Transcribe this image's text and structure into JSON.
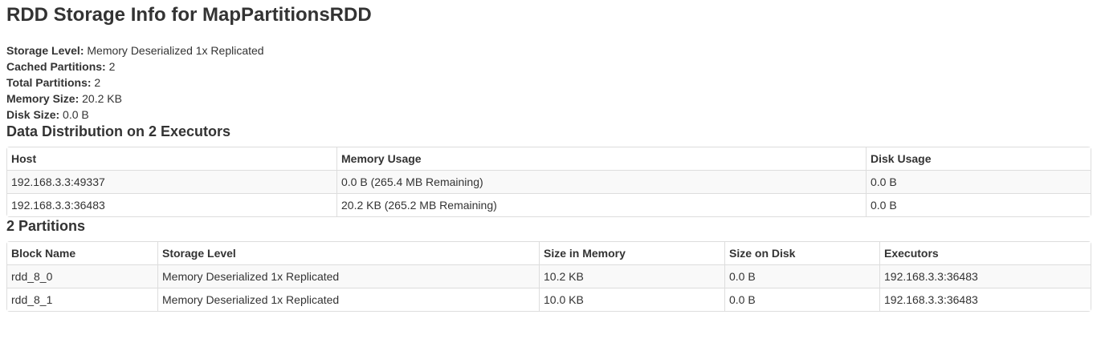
{
  "page": {
    "title": "RDD Storage Info for MapPartitionsRDD"
  },
  "summary": {
    "storage_level": {
      "label": "Storage Level:",
      "value": "Memory Deserialized 1x Replicated"
    },
    "cached_partitions": {
      "label": "Cached Partitions:",
      "value": "2"
    },
    "total_partitions": {
      "label": "Total Partitions:",
      "value": "2"
    },
    "memory_size": {
      "label": "Memory Size:",
      "value": "20.2 KB"
    },
    "disk_size": {
      "label": "Disk Size:",
      "value": "0.0 B"
    }
  },
  "executors": {
    "title": "Data Distribution on 2 Executors",
    "headers": [
      "Host",
      "Memory Usage",
      "Disk Usage"
    ],
    "rows": [
      [
        "192.168.3.3:49337",
        "0.0 B (265.4 MB Remaining)",
        "0.0 B"
      ],
      [
        "192.168.3.3:36483",
        "20.2 KB (265.2 MB Remaining)",
        "0.0 B"
      ]
    ]
  },
  "partitions": {
    "title": "2 Partitions",
    "headers": [
      "Block Name",
      "Storage Level",
      "Size in Memory",
      "Size on Disk",
      "Executors"
    ],
    "rows": [
      [
        "rdd_8_0",
        "Memory Deserialized 1x Replicated",
        "10.2 KB",
        "0.0 B",
        "192.168.3.3:36483"
      ],
      [
        "rdd_8_1",
        "Memory Deserialized 1x Replicated",
        "10.0 KB",
        "0.0 B",
        "192.168.3.3:36483"
      ]
    ]
  }
}
